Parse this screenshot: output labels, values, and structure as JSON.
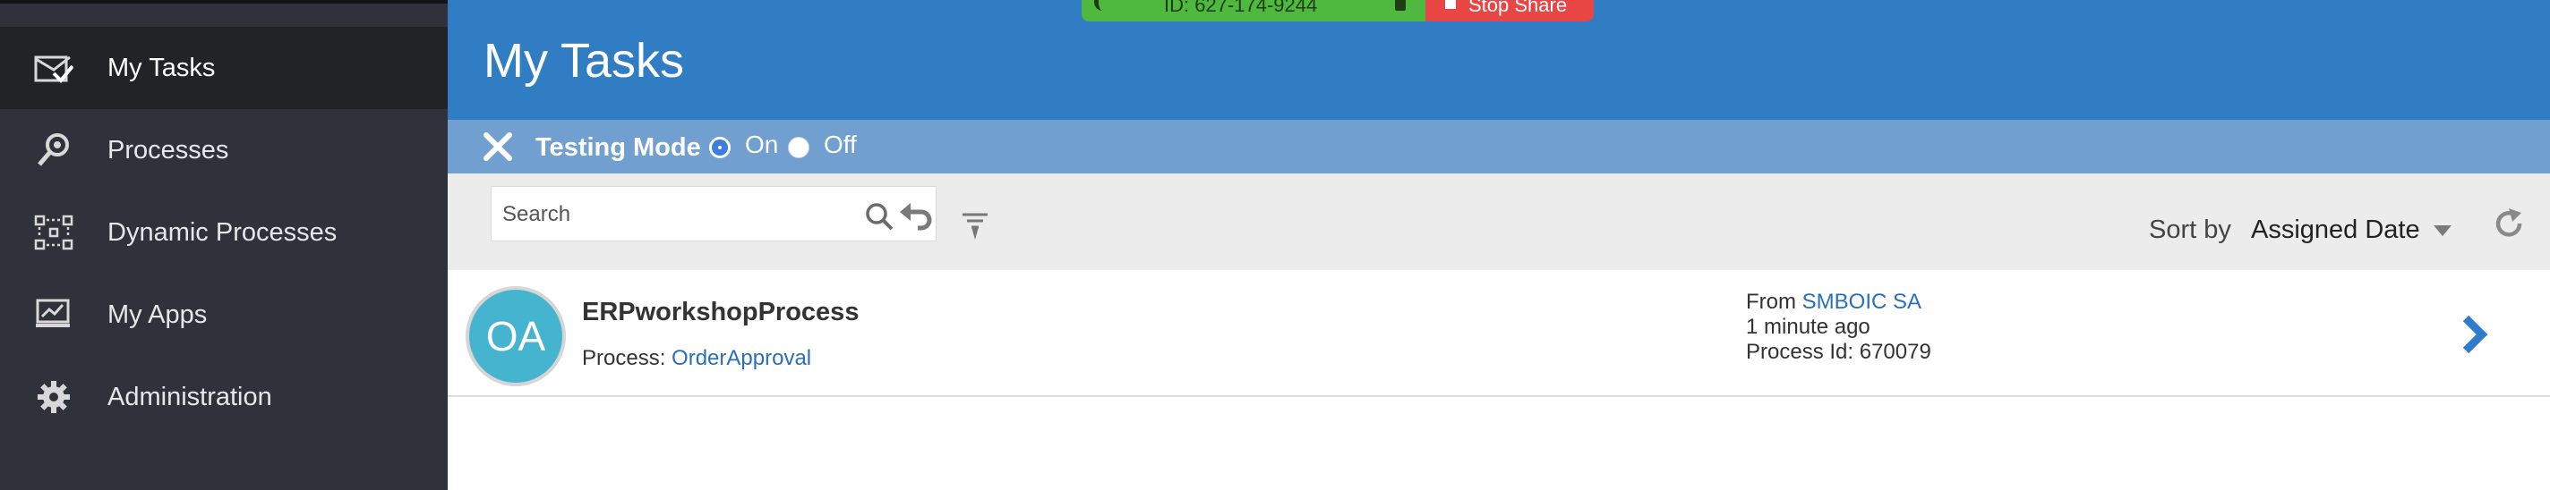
{
  "sidebar": {
    "items": [
      {
        "label": "My Tasks",
        "icon": "inbox-check-icon",
        "active": true
      },
      {
        "label": "Processes",
        "icon": "magnifier-icon"
      },
      {
        "label": "Dynamic Processes",
        "icon": "dashed-flow-icon"
      },
      {
        "label": "My Apps",
        "icon": "chart-monitor-icon"
      },
      {
        "label": "Administration",
        "icon": "gear-icon"
      }
    ]
  },
  "header": {
    "title": "My Tasks",
    "color": "#317dc3"
  },
  "screenshare": {
    "id_text": "ID: 627-174-9244",
    "stop_label": "Stop Share"
  },
  "testing_mode": {
    "label": "Testing Mode",
    "on_label": "On",
    "off_label": "Off",
    "selected": "On"
  },
  "toolbar": {
    "search_placeholder": "Search",
    "sort_label": "Sort by",
    "sort_value": "Assigned Date"
  },
  "tasks": [
    {
      "avatar_initials": "OA",
      "name": "ERPworkshopProcess",
      "process_prefix": "Process:",
      "process_name": "OrderApproval",
      "from_prefix": "From",
      "from_name": "SMBOIC SA",
      "time_ago": "1 minute ago",
      "process_id": "Process Id: 670079"
    }
  ]
}
